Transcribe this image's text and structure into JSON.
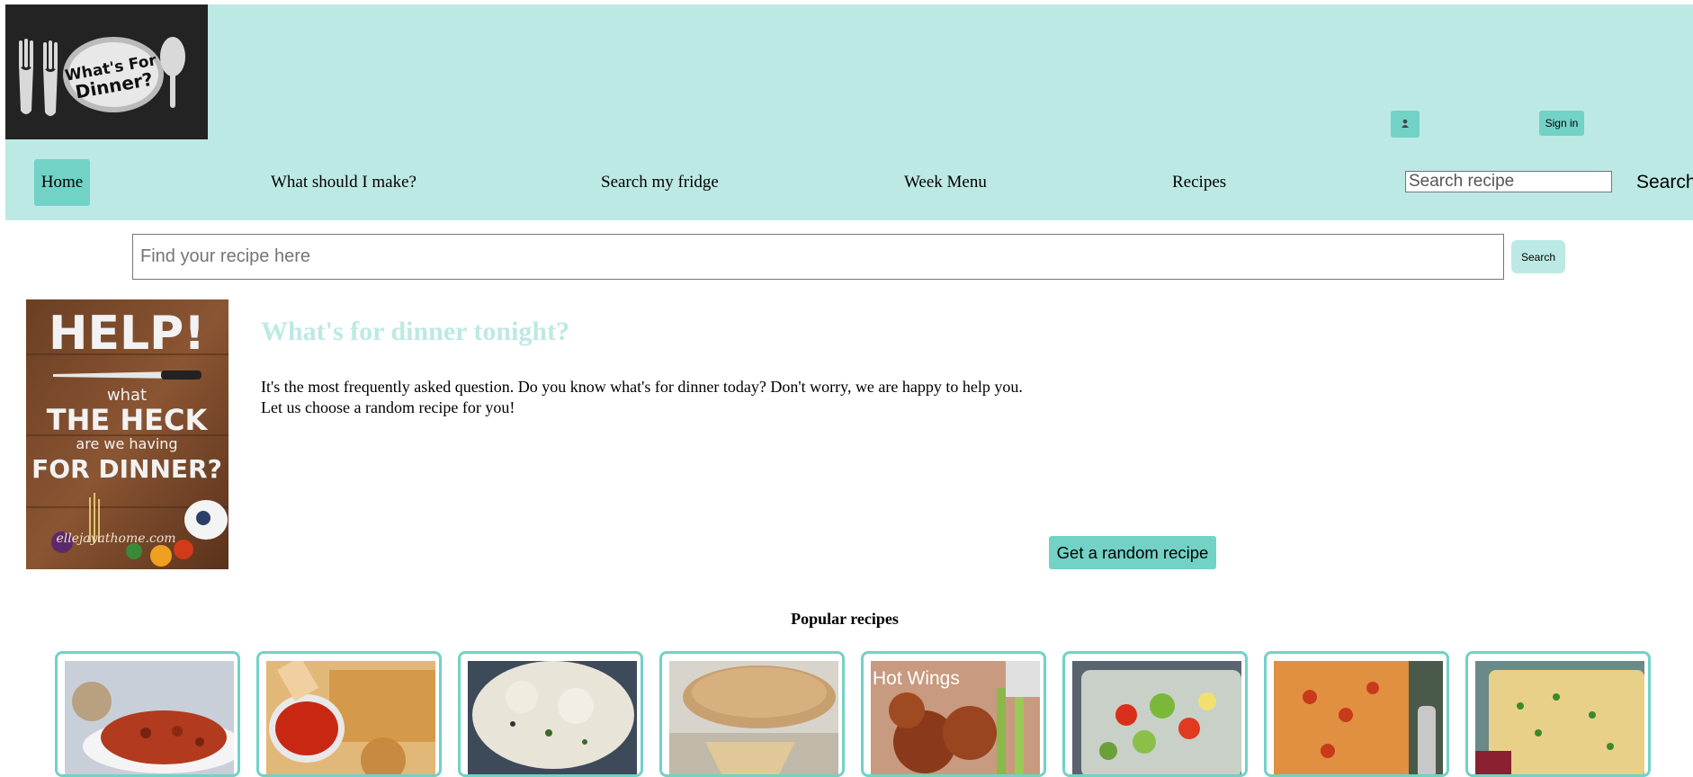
{
  "header": {
    "logo_text": [
      "What's For",
      "Dinner?"
    ],
    "user_icon": "user-icon",
    "signin_label": "Sign in",
    "nav": [
      {
        "label": "Home",
        "active": true
      },
      {
        "label": "What should I make?"
      },
      {
        "label": "Search my fridge"
      },
      {
        "label": "Week Menu"
      },
      {
        "label": "Recipes"
      }
    ],
    "search_placeholder": "Search recipe",
    "search_label": "Search"
  },
  "search": {
    "placeholder": "Find your recipe here",
    "button_label": "Search"
  },
  "intro": {
    "poster_text": [
      "HELP!",
      "what",
      "THE HECK",
      "are we having",
      "FOR DINNER?",
      "ellejayathome.com"
    ],
    "title": "What's for dinner tonight?",
    "text": "It's the most frequently asked question. Do you know what's for dinner today? Don't worry, we are happy to help you. Let us choose a random recipe for you!",
    "random_button": "Get a random recipe"
  },
  "popular": {
    "heading": "Popular recipes",
    "cards": [
      {
        "caption": ""
      },
      {
        "caption": ""
      },
      {
        "caption": ""
      },
      {
        "caption": ""
      },
      {
        "caption": "Hot Wings"
      },
      {
        "caption": ""
      },
      {
        "caption": ""
      },
      {
        "caption": ""
      }
    ]
  },
  "colors": {
    "header_bg": "#bde9e4",
    "accent": "#72d2c6",
    "logo_bg": "#232323"
  }
}
